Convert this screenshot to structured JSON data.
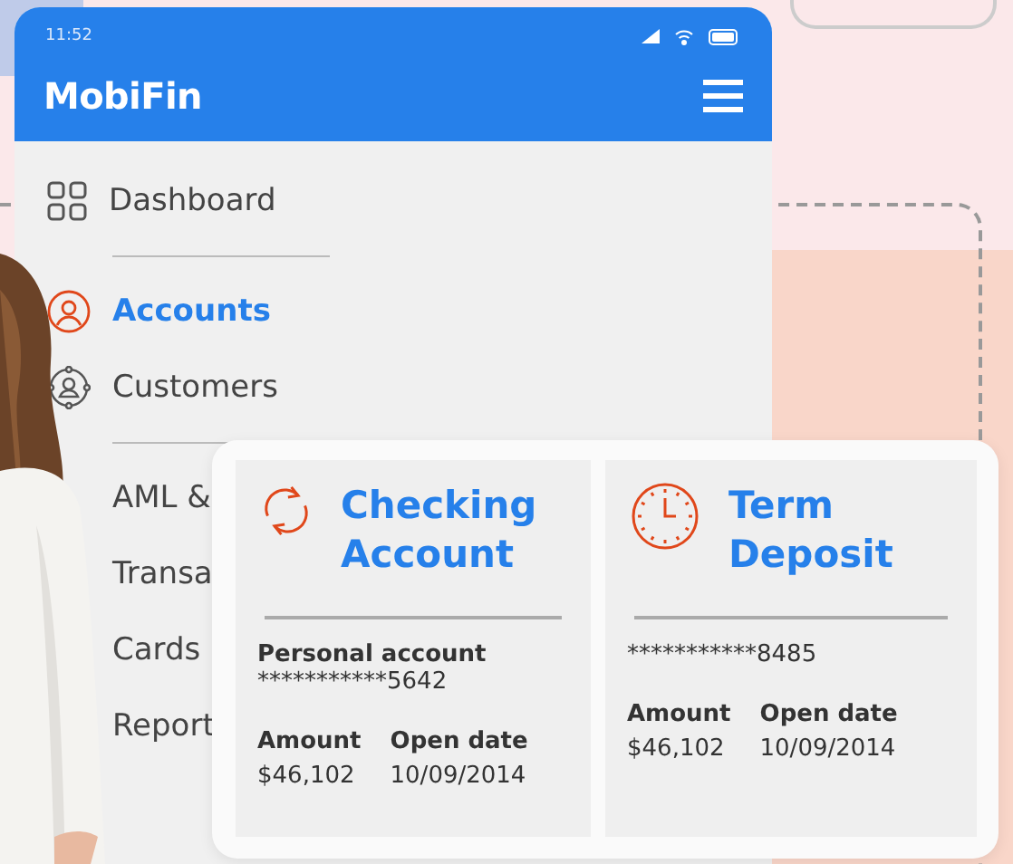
{
  "status_bar": {
    "time": "11:52"
  },
  "app_bar": {
    "logo": "MobiFin"
  },
  "menu": {
    "groups": [
      {
        "items": [
          {
            "label": "Dashboard",
            "selected": false
          }
        ]
      },
      {
        "items": [
          {
            "label": "Accounts",
            "selected": true
          },
          {
            "label": "Customers",
            "selected": false
          }
        ]
      },
      {
        "items": [
          {
            "label": "AML &",
            "selected": false
          },
          {
            "label": "Transa",
            "selected": false
          },
          {
            "label": "Cards",
            "selected": false
          },
          {
            "label": "Report",
            "selected": false
          }
        ]
      }
    ]
  },
  "accounts": [
    {
      "kind": "checking",
      "title": "Checking Account",
      "subtitle": "Personal account",
      "number": "***********5642",
      "fields": [
        {
          "label": "Amount",
          "value": "$46,102"
        },
        {
          "label": "Open date",
          "value": "10/09/2014"
        }
      ]
    },
    {
      "kind": "deposit",
      "title": "Term Deposit",
      "number": "***********8485",
      "fields": [
        {
          "label": "Amount",
          "value": "$46,102"
        },
        {
          "label": "Open date",
          "value": "10/09/2014"
        }
      ]
    }
  ]
}
